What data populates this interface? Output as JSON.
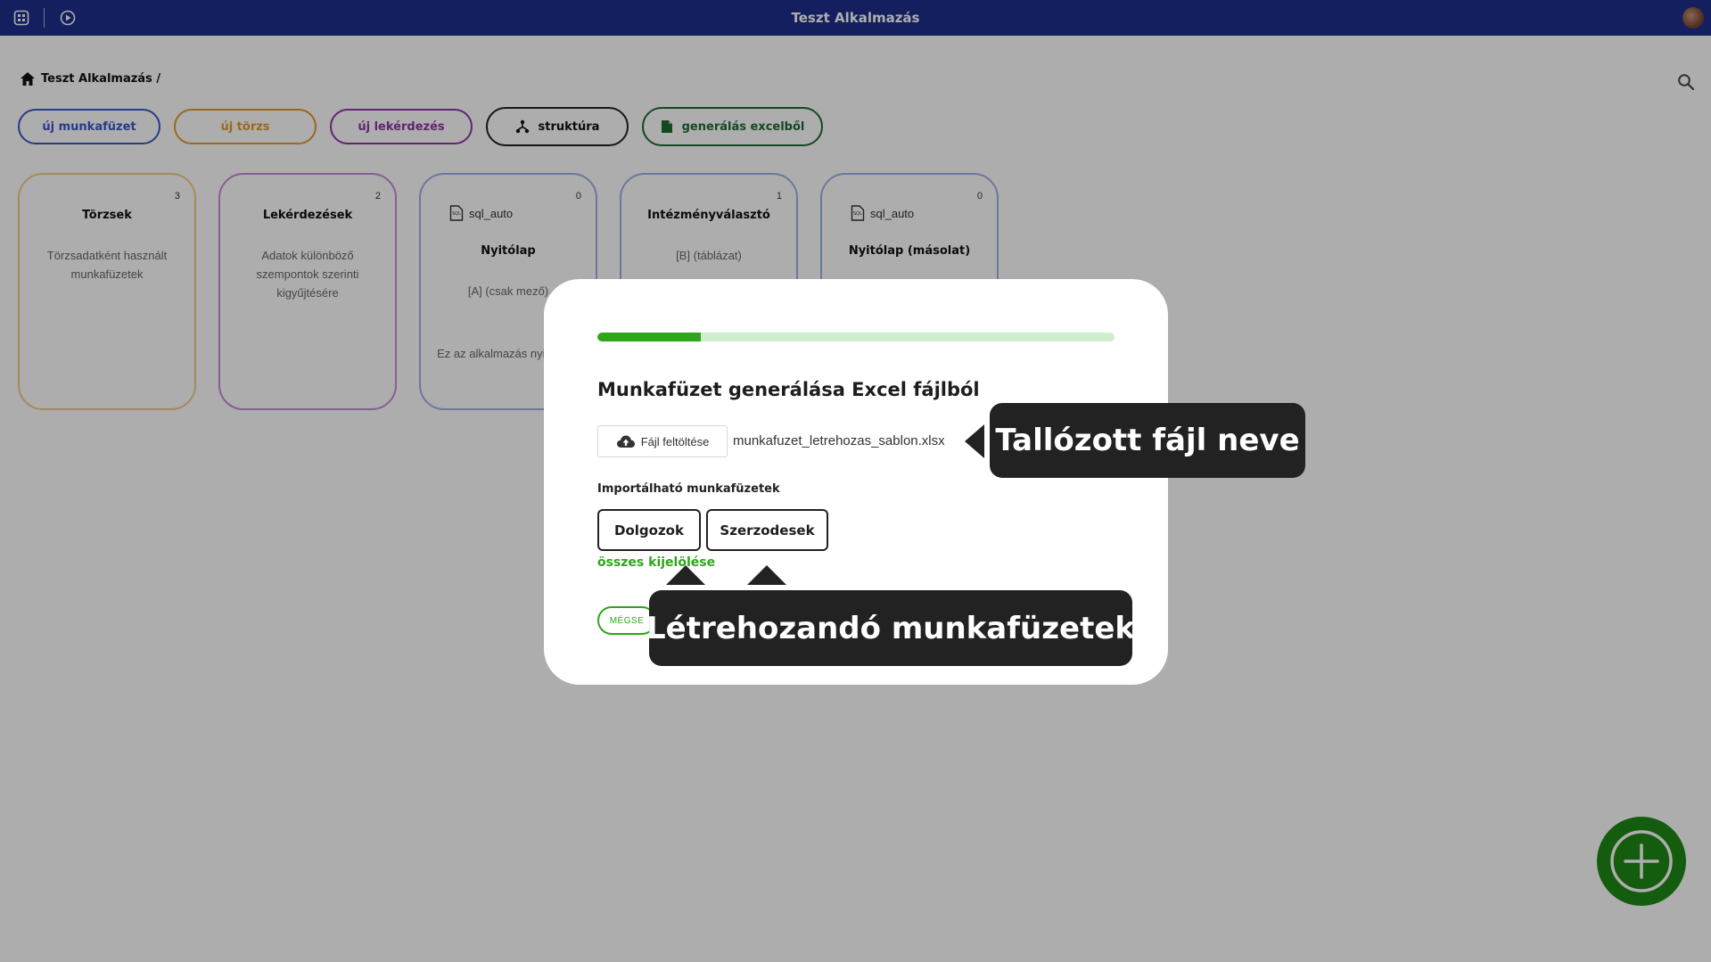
{
  "app": {
    "title": "Teszt Alkalmazás"
  },
  "breadcrumb": {
    "label": "Teszt Alkalmazás /"
  },
  "actions": [
    {
      "label": "új munkafüzet",
      "color": "#3a57c9"
    },
    {
      "label": "új törzs",
      "color": "#e39a2d"
    },
    {
      "label": "új lekérdezés",
      "color": "#8e35a6"
    },
    {
      "label": "struktúra",
      "color": "#222222",
      "icon": "hierarchy-icon"
    },
    {
      "label": "generálás excelből",
      "color": "#1f6a33",
      "icon": "document-icon"
    }
  ],
  "cards": [
    {
      "title": "Törzsek",
      "count": "3",
      "desc": "Törzsadatként használt munkafüzetek",
      "color": "#f0cd88"
    },
    {
      "title": "Lekérdezések",
      "count": "2",
      "desc": "Adatok különböző szempontok szerinti kigyűjtésére",
      "color": "#c68cd8"
    },
    {
      "title": "Nyitólap",
      "count": "0",
      "sql": "sql_auto",
      "sub": "[A] (csak mező)",
      "desc": "Ez az alkalmazás nyitólapja",
      "color": "#9fb1e6"
    },
    {
      "title": "Intézményválasztó",
      "count": "1",
      "sub": "[B] (táblázat)",
      "color": "#9fb1e6"
    },
    {
      "title": "Nyitólap (másolat)",
      "count": "0",
      "sql": "sql_auto",
      "color": "#9fb1e6"
    }
  ],
  "modal": {
    "progress": 0.2,
    "title": "Munkafüzet generálása Excel fájlból",
    "upload_label": "Fájl feltöltése",
    "file_name": "munkafuzet_letrehozas_sablon.xlsx",
    "import_label": "Importálható munkafüzetek",
    "workbooks": [
      "Dolgozok",
      "Szerzodesek"
    ],
    "select_all": "összes kijelölése",
    "cancel": "MÉGSE"
  },
  "tooltips": {
    "file": "Tallózott fájl neve",
    "workbooks": "Létrehozandó munkafüzetek"
  },
  "colors": {
    "topbar": "#1c2e8c",
    "accent_green": "#2fa51c",
    "fab": "#1f8a16"
  },
  "icons": {
    "fab": "plus-circle-icon",
    "upload": "cloud-upload-icon",
    "search": "search-icon",
    "home": "home-icon"
  }
}
